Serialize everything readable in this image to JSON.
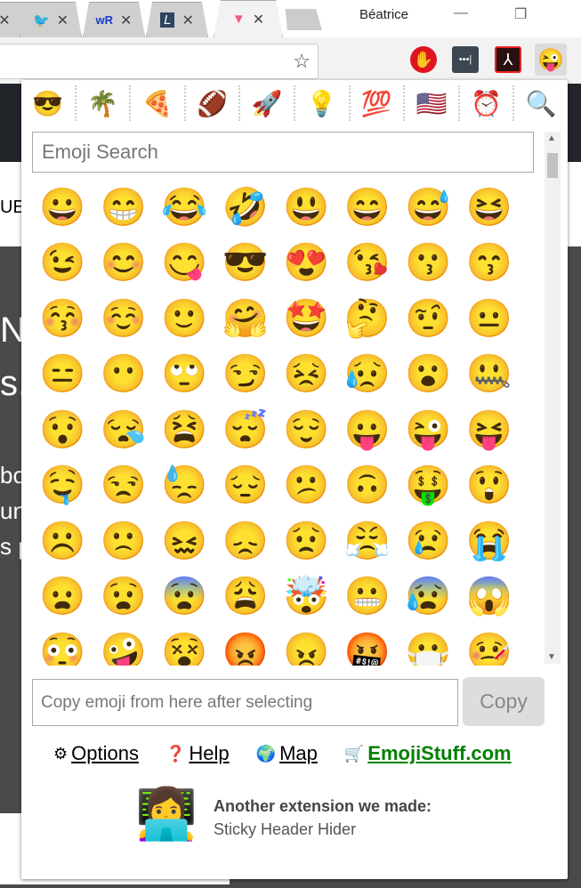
{
  "browser": {
    "tabs": [
      {
        "icon": "twitter-icon",
        "glyph": "🐦"
      },
      {
        "icon": "wordreference-icon",
        "glyph": "wR"
      },
      {
        "icon": "letterboxd-l-icon",
        "glyph": "L"
      },
      {
        "icon": "app-logo-icon",
        "glyph": "▼",
        "active": true
      }
    ],
    "close_glyph": "✕",
    "user": "Béatrice",
    "minimize_glyph": "—",
    "restore_glyph": "❐",
    "bookmark_glyph": "☆",
    "extensions": [
      {
        "name": "adblock",
        "glyph": "✋",
        "color": "#e0141e"
      },
      {
        "name": "lastpass",
        "glyph": "•••|",
        "color": "#3c4751"
      },
      {
        "name": "acrobat",
        "glyph": "⅄",
        "color": "#2a1010"
      },
      {
        "name": "emoji-keyboard",
        "glyph": "😜",
        "color": "#dcdcdc"
      }
    ]
  },
  "page_bg": {
    "fragment_ue": "UE",
    "fragment_n": "N",
    "fragment_s": "s.",
    "fragment_bo": "bo",
    "fragment_un": "un",
    "fragment_p": "s p"
  },
  "popup": {
    "categories": [
      "😎",
      "🌴",
      "🍕",
      "🏈",
      "🚀",
      "💡",
      "💯",
      "🇺🇸",
      "⏰",
      "🔍"
    ],
    "category_names": [
      "smileys",
      "nature",
      "food",
      "activity",
      "travel",
      "objects",
      "symbols",
      "flags",
      "recent",
      "search"
    ],
    "search_placeholder": "Emoji Search",
    "emojis": [
      "😀",
      "😁",
      "😂",
      "🤣",
      "😃",
      "😄",
      "😅",
      "😆",
      "😉",
      "😊",
      "😋",
      "😎",
      "😍",
      "😘",
      "😗",
      "😙",
      "😚",
      "☺️",
      "🙂",
      "🤗",
      "🤩",
      "🤔",
      "🤨",
      "😐",
      "😑",
      "😶",
      "🙄",
      "😏",
      "😣",
      "😥",
      "😮",
      "🤐",
      "😯",
      "😪",
      "😫",
      "😴",
      "😌",
      "😛",
      "😜",
      "😝",
      "🤤",
      "😒",
      "😓",
      "😔",
      "😕",
      "🙃",
      "🤑",
      "😲",
      "☹️",
      "🙁",
      "😖",
      "😞",
      "😟",
      "😤",
      "😢",
      "😭",
      "😦",
      "😧",
      "😨",
      "😩",
      "🤯",
      "😬",
      "😰",
      "😱",
      "😳",
      "🤪",
      "😵",
      "😡",
      "😠",
      "🤬",
      "😷",
      "🤒"
    ],
    "copy_placeholder": "Copy emoji from here after selecting",
    "copy_value": "",
    "copy_label": "Copy",
    "links": {
      "options": {
        "icon": "⚙",
        "label": "Options"
      },
      "help": {
        "icon": "❓",
        "label": "Help"
      },
      "map": {
        "icon": "🌍",
        "label": "Map"
      },
      "shop": {
        "icon": "🛒",
        "label": "EmojiStuff.com",
        "color": "#008000"
      }
    },
    "promo": {
      "avatar": "👩‍💻",
      "title": "Another extension we made:",
      "link": "Sticky Header Hider"
    }
  }
}
